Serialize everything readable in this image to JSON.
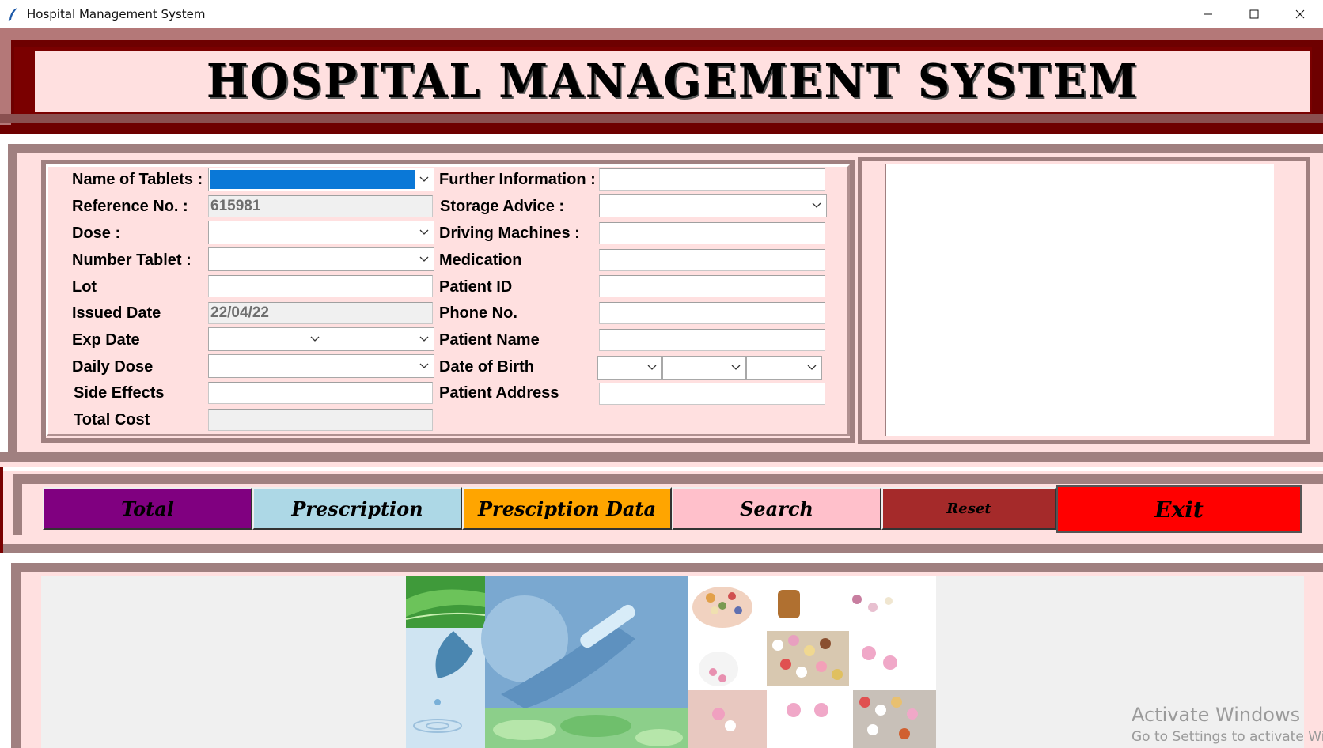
{
  "window": {
    "title": "Hospital Management System"
  },
  "header": {
    "title": "HOSPITAL MANAGEMENT SYSTEM"
  },
  "form": {
    "left_labels": [
      "Name of Tablets :",
      "Reference No. :",
      "Dose :",
      "Number Tablet :",
      "Lot",
      "Issued Date",
      "Exp Date",
      "Daily Dose",
      "Side Effects",
      "Total Cost"
    ],
    "right_labels": [
      "Further Information :",
      "Storage Advice :",
      "Driving Machines :",
      "Medication",
      "Patient ID",
      "Phone No.",
      "Patient Name",
      "Date of Birth",
      "Patient Address"
    ],
    "reference_no_value": "615981",
    "issued_date_value": "22/04/22"
  },
  "buttons": {
    "total": "Total",
    "prescription": "Prescription",
    "prescription_data": "Presciption Data",
    "search": "Search",
    "reset": "Reset",
    "exit": "Exit"
  },
  "colors": {
    "header_dark": "#7a0000",
    "panel_pink": "#ffe0e0",
    "border_mauve": "#a08080",
    "btn_total": "#800080",
    "btn_prescription": "#add8e6",
    "btn_prescription_data": "#ffa500",
    "btn_search": "#ffc0cb",
    "btn_reset": "#a52a2a",
    "btn_exit": "#ff0000",
    "selection_blue": "#0a78d7"
  },
  "watermark": {
    "line1": "Activate Windows",
    "line2": "Go to Settings to activate Windows."
  }
}
